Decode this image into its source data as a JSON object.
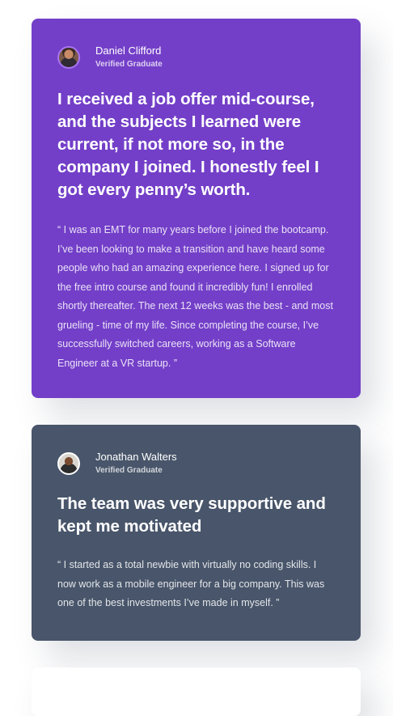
{
  "testimonials": [
    {
      "name": "Daniel Clifford",
      "role": "Verified Graduate",
      "headline": "I received a job offer mid-course, and the subjects I learned were current, if not more so, in the company I joined. I honestly feel I got every penny’s worth.",
      "quote": "“ I was an EMT for many years before I joined the bootcamp. I’ve been looking to make a transition and have heard some people who had an amazing experience here. I signed up for the free intro course and found it incredibly fun! I enrolled shortly thereafter. The next 12 weeks was the best - and most grueling - time of my life. Since completing the course, I’ve successfully switched careers, working as a Software Engineer at a VR startup. ”",
      "accent": "#733fc8"
    },
    {
      "name": "Jonathan Walters",
      "role": "Verified Graduate",
      "headline": "The team was very supportive and kept me motivated",
      "quote": "“ I started as a total newbie with virtually no coding skills. I now work as a mobile engineer for a big company. This was one of the best investments I’ve made in myself. ”",
      "accent": "#48556a"
    }
  ]
}
